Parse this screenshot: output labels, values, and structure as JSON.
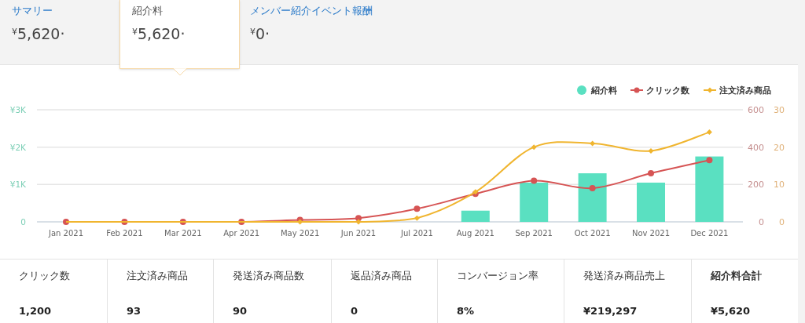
{
  "tabs": [
    {
      "label": "サマリー",
      "value": "$^{¥}$5,620·",
      "selected": false
    },
    {
      "label": "紹介料",
      "value": "$^{¥}$5,620·",
      "selected": true
    },
    {
      "label": "メンバー紹介イベント報酬",
      "value": "$^{¥}$0·",
      "selected": false
    }
  ],
  "chart": {
    "chart_data": {
      "type": "bar",
      "stacked": false,
      "categories": [
        "Jan 2021",
        "Feb 2021",
        "Mar 2021",
        "Apr 2021",
        "May 2021",
        "Jun 2021",
        "Jul 2021",
        "Aug 2021",
        "Sep 2021",
        "Oct 2021",
        "Nov 2021",
        "Dec 2021"
      ],
      "series": [
        {
          "name": "紹介料",
          "type": "bar",
          "color": "#5ae0c1",
          "values": [
            0,
            0,
            0,
            0,
            0,
            0,
            0,
            300,
            1050,
            1300,
            1050,
            1750
          ]
        },
        {
          "name": "クリック数",
          "type": "line",
          "axis": "y2",
          "marker": "circle",
          "color": "#d65454",
          "values": [
            0,
            0,
            0,
            0,
            10,
            20,
            70,
            150,
            220,
            180,
            260,
            330
          ]
        },
        {
          "name": "注文済み商品",
          "type": "line",
          "axis": "y3",
          "marker": "diamond",
          "color": "#f0b52f",
          "values": [
            0,
            0,
            0,
            0,
            0,
            0,
            1,
            8,
            20,
            21,
            19,
            24
          ]
        }
      ],
      "legend": "top right",
      "ylim": [
        0,
        3000
      ],
      "y2lim": [
        0,
        600
      ],
      "y3lim": [
        0,
        30
      ],
      "yticks": [
        {
          "value": 0,
          "label": "0"
        },
        {
          "value": 1000,
          "label": "¥1K"
        },
        {
          "value": 2000,
          "label": "¥2K"
        },
        {
          "value": 3000,
          "label": "¥3K"
        }
      ],
      "y2ticks": [
        {
          "value": 0,
          "label": "0"
        },
        {
          "value": 200,
          "label": "200"
        },
        {
          "value": 400,
          "label": "400"
        },
        {
          "value": 600,
          "label": "600"
        }
      ],
      "y3ticks": [
        {
          "value": 0,
          "label": "0"
        },
        {
          "value": 10,
          "label": "10"
        },
        {
          "value": 20,
          "label": "20"
        },
        {
          "value": 30,
          "label": "30"
        }
      ]
    }
  },
  "stats": [
    {
      "label": "クリック数",
      "value": "1,200",
      "emphasized": false
    },
    {
      "label": "注文済み商品",
      "value": "93",
      "emphasized": false
    },
    {
      "label": "発送済み商品数",
      "value": "90",
      "emphasized": false
    },
    {
      "label": "返品済み商品",
      "value": "0",
      "emphasized": false
    },
    {
      "label": "コンバージョン率",
      "value": "8%",
      "emphasized": false
    },
    {
      "label": "発送済み商品売上",
      "value": "¥219,297",
      "emphasized": false
    },
    {
      "label": "紹介料合計",
      "value": "¥5,620",
      "emphasized": true
    }
  ]
}
